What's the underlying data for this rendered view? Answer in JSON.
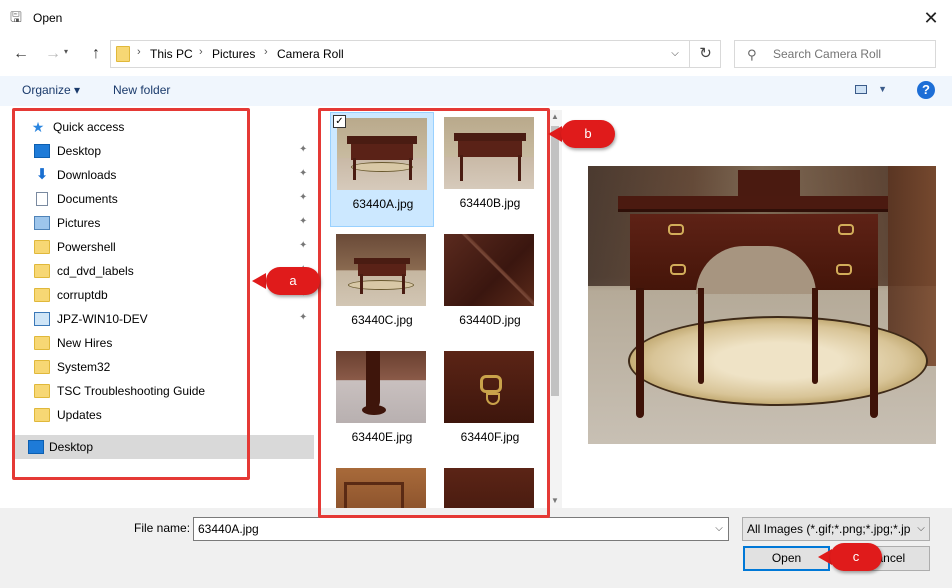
{
  "window": {
    "title": "Open",
    "close_glyph": "✕"
  },
  "nav": {
    "back_glyph": "←",
    "forward_glyph": "→",
    "up_glyph": "↑",
    "breadcrumbs": [
      "This PC",
      "Pictures",
      "Camera Roll"
    ],
    "search_placeholder": "Search Camera Roll"
  },
  "toolbar": {
    "organize_label": "Organize ▾",
    "new_folder_label": "New folder",
    "help_label": "?"
  },
  "sidebar": {
    "quick_access_label": "Quick access",
    "items": [
      {
        "label": "Desktop",
        "icon": "desktop-icon",
        "pinned": true
      },
      {
        "label": "Downloads",
        "icon": "download-icon",
        "pinned": true
      },
      {
        "label": "Documents",
        "icon": "documents-icon",
        "pinned": true
      },
      {
        "label": "Pictures",
        "icon": "pictures-icon",
        "pinned": true
      },
      {
        "label": "Powershell",
        "icon": "folder-icon",
        "pinned": true
      },
      {
        "label": "cd_dvd_labels",
        "icon": "folder-icon",
        "pinned": true
      },
      {
        "label": "corruptdb",
        "icon": "folder-icon",
        "pinned": true
      },
      {
        "label": "JPZ-WIN10-DEV",
        "icon": "computer-icon",
        "pinned": true
      },
      {
        "label": "New Hires",
        "icon": "folder-icon",
        "pinned": false
      },
      {
        "label": "System32",
        "icon": "folder-icon",
        "pinned": false
      },
      {
        "label": "TSC Troubleshooting Guide",
        "icon": "folder-icon",
        "pinned": false
      },
      {
        "label": "Updates",
        "icon": "folder-icon",
        "pinned": false
      }
    ],
    "desktop_root_label": "Desktop",
    "pin_glyph": "📌"
  },
  "files": [
    {
      "name": "63440A.jpg",
      "selected": true
    },
    {
      "name": "63440B.jpg",
      "selected": false
    },
    {
      "name": "63440C.jpg",
      "selected": false
    },
    {
      "name": "63440D.jpg",
      "selected": false
    },
    {
      "name": "63440E.jpg",
      "selected": false
    },
    {
      "name": "63440F.jpg",
      "selected": false
    }
  ],
  "footer": {
    "file_name_label": "File name:",
    "file_name_value": "63440A.jpg",
    "filter_value": "All Images (*.gif;*.png;*.jpg;*.jp",
    "open_label": "Open",
    "cancel_label": "Cancel"
  },
  "annotations": {
    "a": "a",
    "b": "b",
    "c": "c"
  },
  "colors": {
    "accent": "#0078d7",
    "annotation_red": "#e53935",
    "selection": "#cce8ff"
  }
}
